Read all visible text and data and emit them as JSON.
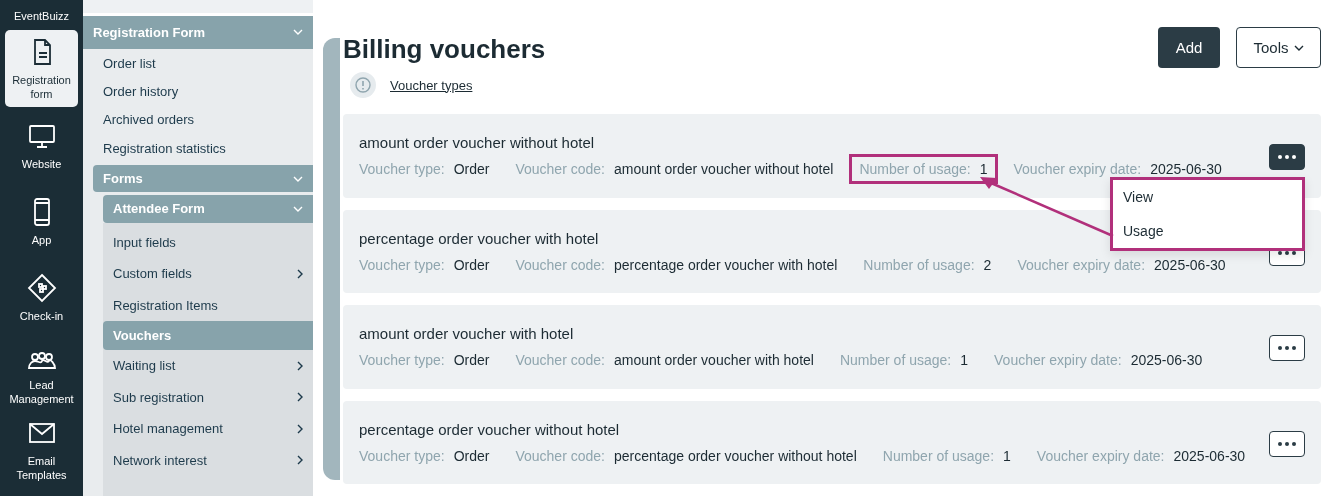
{
  "nav": {
    "brand": "EventBuizz",
    "items": [
      {
        "kind": "document",
        "label": "Registration form",
        "selected": true
      },
      {
        "kind": "monitor",
        "label": "Website",
        "selected": false
      },
      {
        "kind": "phone",
        "label": "App",
        "selected": false
      },
      {
        "kind": "ticket",
        "label": "Check-in",
        "selected": false
      },
      {
        "kind": "people",
        "label": "Lead Management",
        "selected": false
      },
      {
        "kind": "mail",
        "label": "Email Templates",
        "selected": false
      }
    ]
  },
  "sidebar": {
    "label": "Registration Form",
    "expanded": true,
    "children": [
      {
        "label": "Order list",
        "selected": false
      },
      {
        "label": "Order history",
        "selected": false
      },
      {
        "label": "Archived orders",
        "selected": false
      },
      {
        "label": "Registration statistics",
        "selected": false
      },
      {
        "label": "Forms",
        "expanded": true,
        "children": [
          {
            "label": "Attendee Form",
            "expanded": true,
            "children": [
              {
                "label": "Input fields",
                "selected": false,
                "submenu": false
              },
              {
                "label": "Custom fields",
                "selected": false,
                "submenu": true
              },
              {
                "label": "Registration Items",
                "selected": false,
                "submenu": false
              },
              {
                "label": "Vouchers",
                "selected": true,
                "submenu": false
              },
              {
                "label": "Waiting list",
                "selected": false,
                "submenu": true
              },
              {
                "label": "Sub registration",
                "selected": false,
                "submenu": true
              },
              {
                "label": "Hotel management",
                "selected": false,
                "submenu": true
              },
              {
                "label": "Network interest",
                "selected": false,
                "submenu": true
              }
            ]
          }
        ]
      }
    ]
  },
  "page": {
    "title": "Billing vouchers",
    "info_link": "Voucher types",
    "buttons": {
      "add": "Add",
      "tools": "Tools"
    }
  },
  "vouchers": [
    {
      "name": "amount order voucher without hotel",
      "menu_open": true,
      "fields": [
        {
          "label": "Voucher type:",
          "value": "Order",
          "highlighted": false
        },
        {
          "label": "Voucher code:",
          "value": "amount order voucher without hotel",
          "highlighted": false
        },
        {
          "label": "Number of usage:",
          "value": "1",
          "highlighted": true
        },
        {
          "label": "Voucher expiry date:",
          "value": "2025-06-30",
          "highlighted": false
        }
      ]
    },
    {
      "name": "percentage order voucher with hotel",
      "menu_open": false,
      "fields": [
        {
          "label": "Voucher type:",
          "value": "Order",
          "highlighted": false
        },
        {
          "label": "Voucher code:",
          "value": "percentage order voucher with hotel",
          "highlighted": false
        },
        {
          "label": "Number of usage:",
          "value": "2",
          "highlighted": false
        },
        {
          "label": "Voucher expiry date:",
          "value": "2025-06-30",
          "highlighted": false
        }
      ]
    },
    {
      "name": "amount order voucher with hotel",
      "menu_open": false,
      "fields": [
        {
          "label": "Voucher type:",
          "value": "Order",
          "highlighted": false
        },
        {
          "label": "Voucher code:",
          "value": "amount order voucher with hotel",
          "highlighted": false
        },
        {
          "label": "Number of usage:",
          "value": "1",
          "highlighted": false
        },
        {
          "label": "Voucher expiry date:",
          "value": "2025-06-30",
          "highlighted": false
        }
      ]
    },
    {
      "name": "percentage order voucher without hotel",
      "menu_open": false,
      "fields": [
        {
          "label": "Voucher type:",
          "value": "Order",
          "highlighted": false
        },
        {
          "label": "Voucher code:",
          "value": "percentage order voucher without hotel",
          "highlighted": false
        },
        {
          "label": "Number of usage:",
          "value": "1",
          "highlighted": false
        },
        {
          "label": "Voucher expiry date:",
          "value": "2025-06-30",
          "highlighted": false
        }
      ]
    }
  ],
  "action_menu": {
    "items": [
      "View",
      "Usage"
    ],
    "highlighted": true
  }
}
